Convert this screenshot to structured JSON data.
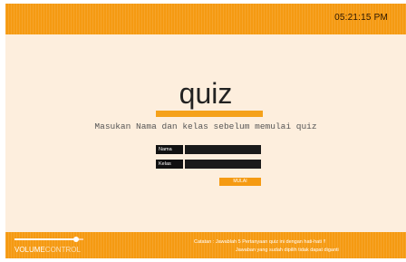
{
  "header": {
    "clock": "05:21:15 PM"
  },
  "quiz": {
    "title": "quiz",
    "subtitle": "Masukan Nama dan kelas sebelum memulai quiz",
    "name_label": "Nama",
    "name_value": "",
    "class_label": "Kelas",
    "class_value": "",
    "start_label": "MULAI"
  },
  "footer": {
    "volume_word": "VOLUME",
    "control_word": "CONTROL",
    "volume_level": 0.9,
    "note_line1": "Catatan : Jawablah 5 Pertanyaan quiz ini dengan hati-hati !!",
    "note_line2": "Jawaban yang sudah dipilih tidak dapat diganti"
  },
  "colors": {
    "accent": "#f59a12",
    "background": "#fdeedd",
    "field": "#1a1a1a"
  }
}
